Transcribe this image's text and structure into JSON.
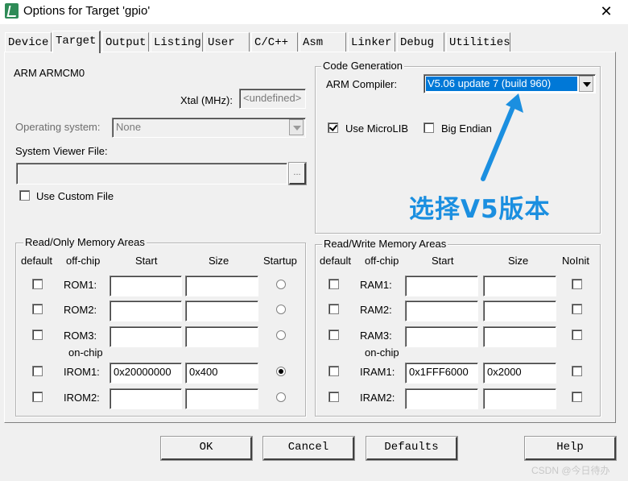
{
  "window": {
    "title": "Options for Target 'gpio'"
  },
  "tabs": [
    {
      "label": "Device",
      "active": false
    },
    {
      "label": "Target",
      "active": true
    },
    {
      "label": "Output",
      "active": false
    },
    {
      "label": "Listing",
      "active": false
    },
    {
      "label": "User",
      "active": false
    },
    {
      "label": "C/C++",
      "active": false
    },
    {
      "label": "Asm",
      "active": false
    },
    {
      "label": "Linker",
      "active": false
    },
    {
      "label": "Debug",
      "active": false
    },
    {
      "label": "Utilities",
      "active": false
    }
  ],
  "device": {
    "name": "ARM ARMCM0"
  },
  "xtal": {
    "label": "Xtal (MHz):",
    "value": "<undefined>"
  },
  "os": {
    "label": "Operating system:",
    "value": "None"
  },
  "svd": {
    "label": "System Viewer File:",
    "value": "",
    "browse_label": "..."
  },
  "custom_file": {
    "label": "Use Custom File",
    "checked": false
  },
  "code_gen": {
    "title": "Code Generation",
    "compiler_label": "ARM Compiler:",
    "compiler_value": "V5.06 update 7 (build 960)",
    "microlib_label": "Use MicroLIB",
    "microlib_checked": true,
    "big_endian_label": "Big Endian",
    "big_endian_checked": false
  },
  "annotation": {
    "text": "选择V5版本",
    "color": "#1b8fe0"
  },
  "ro_memory": {
    "title": "Read/Only Memory Areas",
    "headers": {
      "default": "default",
      "offchip": "off-chip",
      "start": "Start",
      "size": "Size",
      "startup": "Startup"
    },
    "onchip_label": "on-chip",
    "rows": [
      {
        "label": "ROM1:",
        "start": "",
        "size": "",
        "default": false,
        "startup": false
      },
      {
        "label": "ROM2:",
        "start": "",
        "size": "",
        "default": false,
        "startup": false
      },
      {
        "label": "ROM3:",
        "start": "",
        "size": "",
        "default": false,
        "startup": false
      },
      {
        "label": "IROM1:",
        "start": "0x20000000",
        "size": "0x400",
        "default": false,
        "startup": true
      },
      {
        "label": "IROM2:",
        "start": "",
        "size": "",
        "default": false,
        "startup": false
      }
    ]
  },
  "rw_memory": {
    "title": "Read/Write Memory Areas",
    "headers": {
      "default": "default",
      "offchip": "off-chip",
      "start": "Start",
      "size": "Size",
      "noinit": "NoInit"
    },
    "onchip_label": "on-chip",
    "rows": [
      {
        "label": "RAM1:",
        "start": "",
        "size": "",
        "default": false,
        "noinit": false
      },
      {
        "label": "RAM2:",
        "start": "",
        "size": "",
        "default": false,
        "noinit": false
      },
      {
        "label": "RAM3:",
        "start": "",
        "size": "",
        "default": false,
        "noinit": false
      },
      {
        "label": "IRAM1:",
        "start": "0x1FFF6000",
        "size": "0x2000",
        "default": false,
        "noinit": false
      },
      {
        "label": "IRAM2:",
        "start": "",
        "size": "",
        "default": false,
        "noinit": false
      }
    ]
  },
  "buttons": {
    "ok": "OK",
    "cancel": "Cancel",
    "defaults": "Defaults",
    "help": "Help"
  },
  "watermark": "CSDN @今日待办",
  "colors": {
    "selection": "#0078d7",
    "dialog_bg": "#f0f0f0"
  }
}
